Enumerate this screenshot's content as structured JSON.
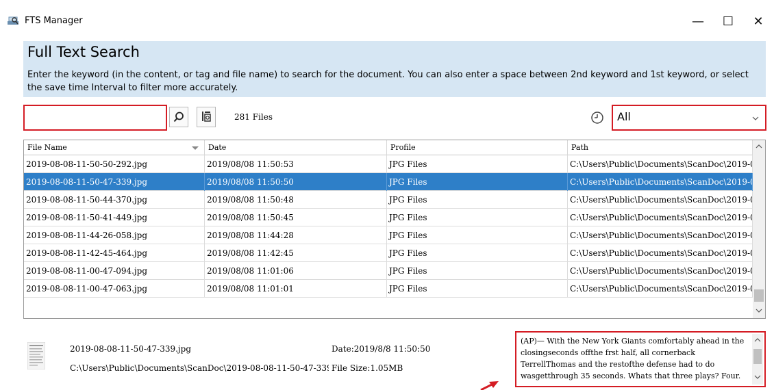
{
  "window": {
    "title": "FTS Manager",
    "minimize_glyph": "—",
    "maximize_glyph": "☐",
    "close_glyph": "✕"
  },
  "header": {
    "title": "Full Text Search",
    "description": "Enter the keyword (in the content, or tag and file name) to search for the document. You can also enter a space between 2nd keyword and 1st keyword, or select the save time Interval to filter more accurately."
  },
  "search": {
    "value": "",
    "placeholder": "",
    "files_count": "281 Files"
  },
  "time_filter": {
    "selected": "All"
  },
  "table": {
    "columns": [
      "File Name",
      "Date",
      "Profile",
      "Path"
    ],
    "rows": [
      {
        "file": "2019-08-08-11-50-50-292.jpg",
        "date": "2019/08/08 11:50:53",
        "profile": "JPG Files",
        "path": "C:\\Users\\Public\\Documents\\ScanDoc\\2019-0..."
      },
      {
        "file": "2019-08-08-11-50-47-339.jpg",
        "date": "2019/08/08 11:50:50",
        "profile": "JPG Files",
        "path": "C:\\Users\\Public\\Documents\\ScanDoc\\2019-0..."
      },
      {
        "file": "2019-08-08-11-50-44-370.jpg",
        "date": "2019/08/08 11:50:48",
        "profile": "JPG Files",
        "path": "C:\\Users\\Public\\Documents\\ScanDoc\\2019-0..."
      },
      {
        "file": "2019-08-08-11-50-41-449.jpg",
        "date": "2019/08/08 11:50:45",
        "profile": "JPG Files",
        "path": "C:\\Users\\Public\\Documents\\ScanDoc\\2019-0..."
      },
      {
        "file": "2019-08-08-11-44-26-058.jpg",
        "date": "2019/08/08 11:44:28",
        "profile": "JPG Files",
        "path": "C:\\Users\\Public\\Documents\\ScanDoc\\2019-0..."
      },
      {
        "file": "2019-08-08-11-42-45-464.jpg",
        "date": "2019/08/08 11:42:45",
        "profile": "JPG Files",
        "path": "C:\\Users\\Public\\Documents\\ScanDoc\\2019-0..."
      },
      {
        "file": "2019-08-08-11-00-47-094.jpg",
        "date": "2019/08/08 11:01:06",
        "profile": "JPG Files",
        "path": "C:\\Users\\Public\\Documents\\ScanDoc\\2019-0..."
      },
      {
        "file": "2019-08-08-11-00-47-063.jpg",
        "date": "2019/08/08 11:01:01",
        "profile": "JPG Files",
        "path": "C:\\Users\\Public\\Documents\\ScanDoc\\2019-0..."
      }
    ],
    "selected_index": 1
  },
  "details": {
    "file_name": "2019-08-08-11-50-47-339.jpg",
    "file_path": "C:\\Users\\Public\\Documents\\ScanDoc\\2019-08-08-11-50-47-339.jp",
    "date": "Date:2019/8/8 11:50:50",
    "size": "File Size:1.05MB",
    "content": "(AP)— With the New York Giants comfortably ahead in the closingseconds offthe frst half, all cornerback TerrellThomas and the restofthe defense had to do wasgetthrough 35 seconds. Whats that three plays? Four."
  },
  "colors": {
    "accent_red": "#d41c24",
    "header_bg": "#d6e6f3",
    "selection_blue": "#2e7fc8"
  },
  "icons": [
    "scanner-app-icon",
    "search-icon",
    "clear-history-icon",
    "clock-icon",
    "chevron-down-icon",
    "scroll-up-icon",
    "scroll-down-icon",
    "document-thumbnail-icon"
  ]
}
